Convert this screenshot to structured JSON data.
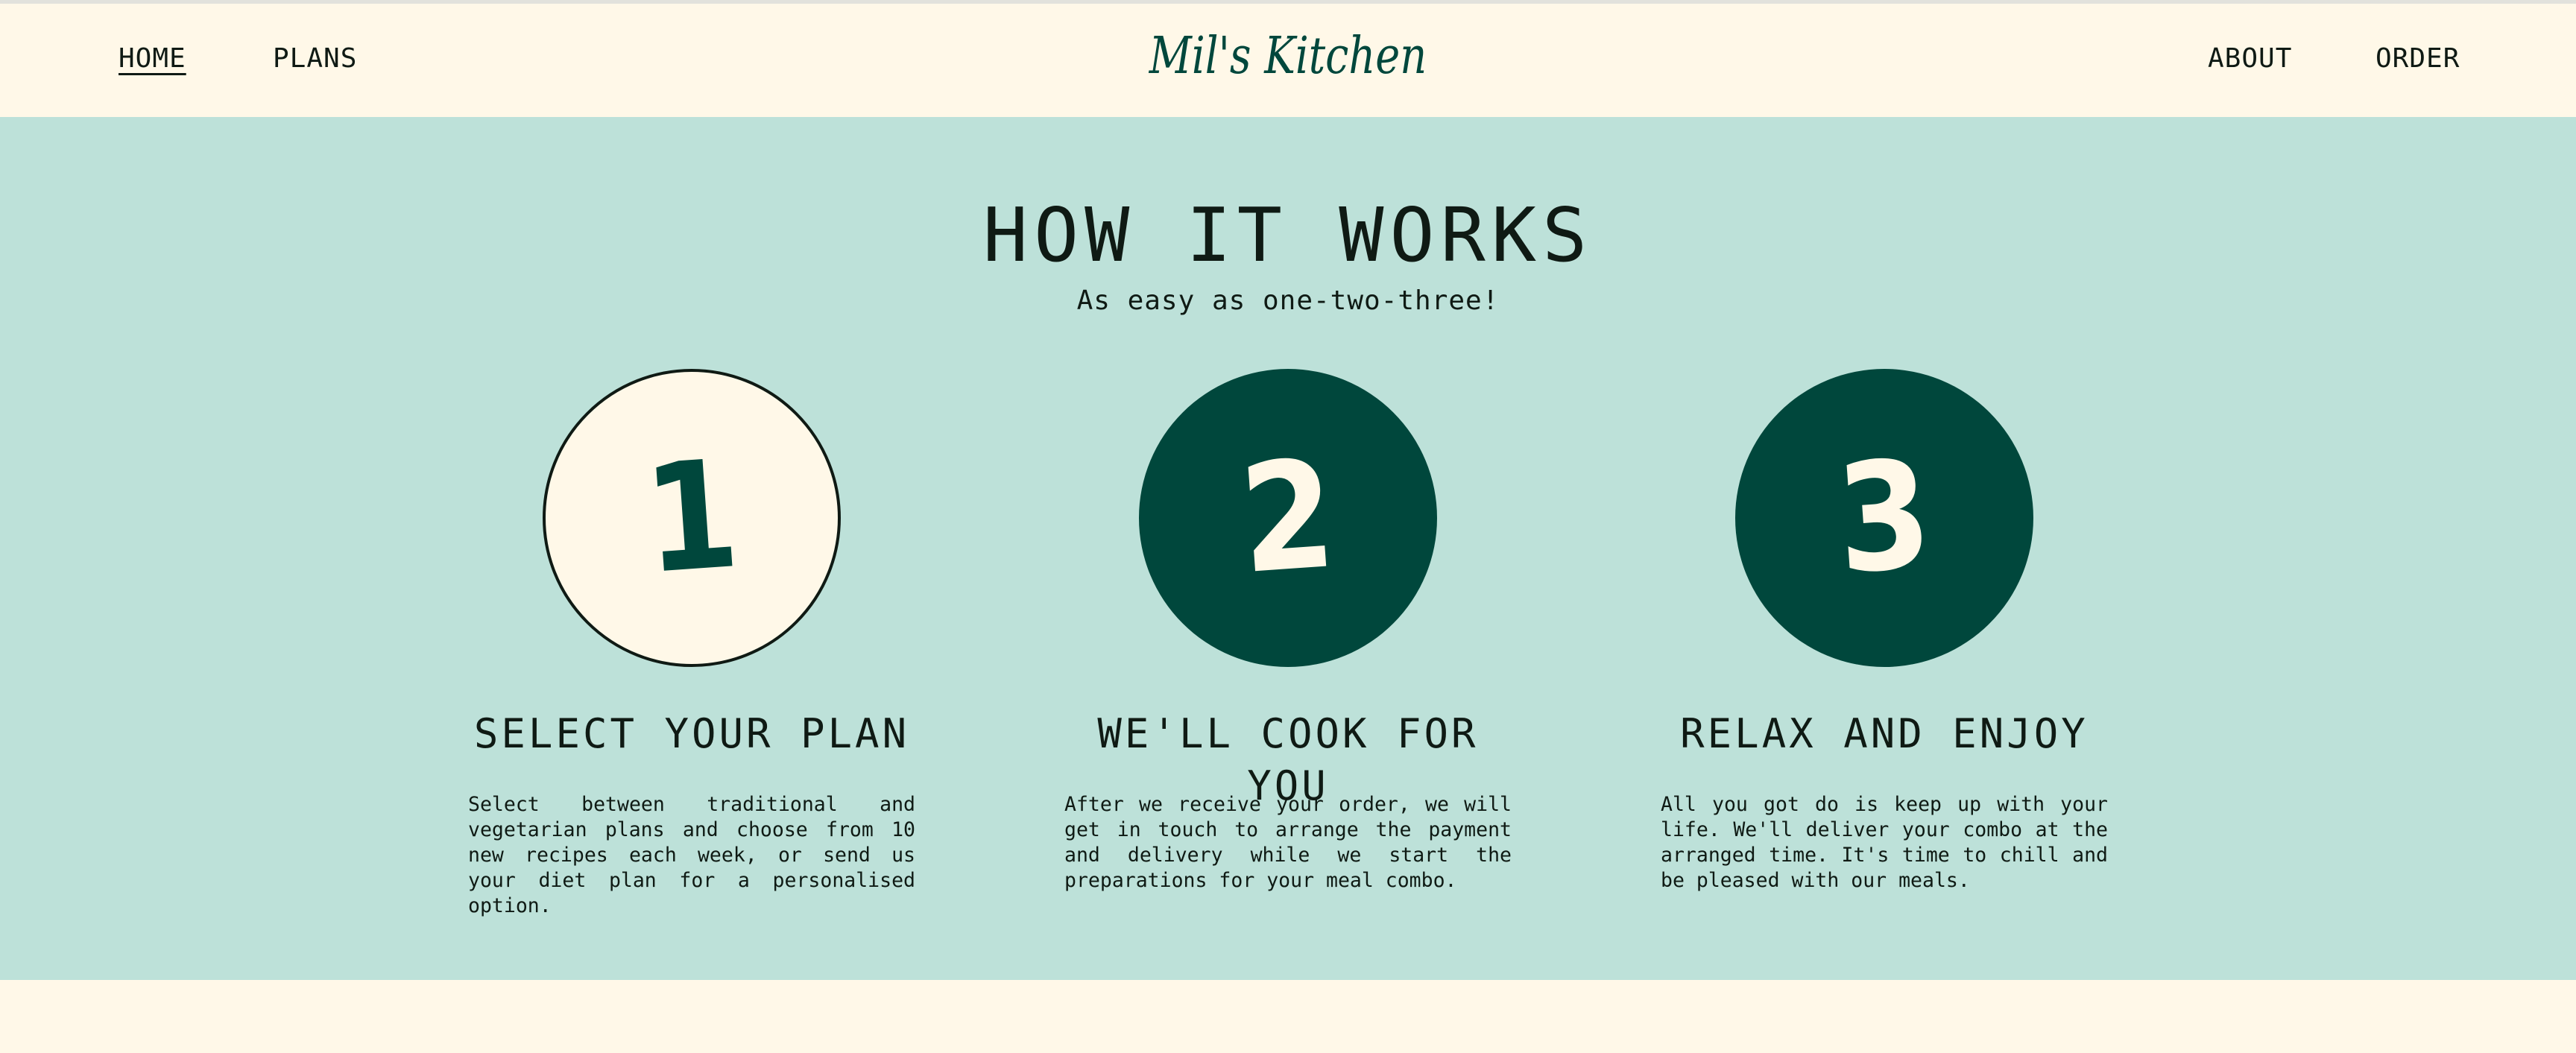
{
  "nav": {
    "brand": "Mil's Kitchen",
    "home": "HOME",
    "plans": "PLANS",
    "about": "ABOUT",
    "order": "ORDER"
  },
  "how": {
    "title": "HOW IT WORKS",
    "subtitle": "As easy as one-two-three!",
    "steps": [
      {
        "number": "1",
        "title": "SELECT YOUR PLAN",
        "text": "Select between traditional and vegetarian plans and choose from 10 new recipes each week, or send us your diet plan for a personalised option."
      },
      {
        "number": "2",
        "title": "WE'LL COOK FOR YOU",
        "text": "After we receive your order, we will get in touch to arrange the payment and delivery while we start the preparations for your meal combo."
      },
      {
        "number": "3",
        "title": "RELAX AND ENJOY",
        "text": "All you got do is keep up with your life. We'll deliver your combo at the arranged time. It's time to chill and be pleased with our meals."
      }
    ]
  },
  "colors": {
    "cream": "#fff8e8",
    "mint": "#bde1d9",
    "dark_green": "#00473c",
    "text": "#0f1a14"
  }
}
